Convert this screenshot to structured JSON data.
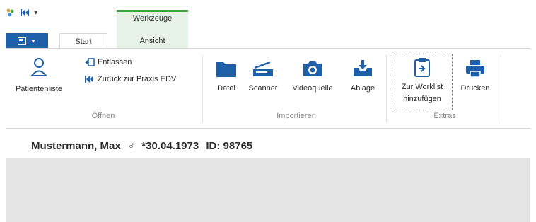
{
  "quick_access": {
    "icons": [
      "app-logo-icon",
      "back-to-edv-icon"
    ],
    "dropdown_glyph": "▾"
  },
  "context_tab_group": {
    "title": "Werkzeuge",
    "color": "#3aa53a"
  },
  "tabs": {
    "file_button_color": "#1f5fa7",
    "start": "Start",
    "ansicht": "Ansicht"
  },
  "ribbon": {
    "oeffnen": {
      "label": "Öffnen",
      "patientenliste": "Patientenliste",
      "entlassen": "Entlassen",
      "zurueck": "Zurück zur Praxis EDV"
    },
    "importieren": {
      "label": "Importieren",
      "datei": "Datei",
      "scanner": "Scanner",
      "videoquelle": "Videoquelle",
      "ablage": "Ablage"
    },
    "extras": {
      "label": "Extras",
      "worklist_line1": "Zur Worklist",
      "worklist_line2": "hinzufügen",
      "drucken": "Drucken"
    }
  },
  "patient": {
    "name": "Mustermann, Max",
    "sex_symbol": "♂",
    "birthdate": "*30.04.1973",
    "id": "ID: 98765"
  },
  "colors": {
    "accent_blue": "#1f5fa7",
    "icon_blue": "#1f5fa7",
    "content_grey": "#e4e4e4"
  }
}
